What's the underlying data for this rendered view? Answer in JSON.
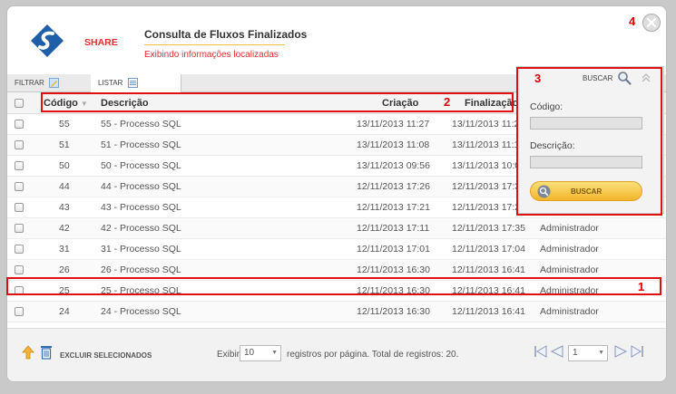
{
  "header": {
    "brand": "SHARE",
    "title": "Consulta de Fluxos Finalizados",
    "subtitle": "Exibindo informações localizadas"
  },
  "tabs": {
    "filter": "FILTRAR",
    "list": "LISTAR"
  },
  "table": {
    "columns": [
      "Código",
      "Descrição",
      "Criação",
      "Finalização"
    ],
    "rows": [
      {
        "codigo": "55",
        "descricao": "55 - Processo SQL",
        "criacao": "13/11/2013 11:27",
        "finalizacao": "13/11/2013 11:2",
        "usuario": ""
      },
      {
        "codigo": "51",
        "descricao": "51 - Processo SQL",
        "criacao": "13/11/2013 11:08",
        "finalizacao": "13/11/2013 11:1",
        "usuario": ""
      },
      {
        "codigo": "50",
        "descricao": "50 - Processo SQL",
        "criacao": "13/11/2013 09:56",
        "finalizacao": "13/11/2013 10:0",
        "usuario": ""
      },
      {
        "codigo": "44",
        "descricao": "44 - Processo SQL",
        "criacao": "12/11/2013 17:26",
        "finalizacao": "12/11/2013 17:3",
        "usuario": ""
      },
      {
        "codigo": "43",
        "descricao": "43 - Processo SQL",
        "criacao": "12/11/2013 17:21",
        "finalizacao": "12/11/2013 17:2",
        "usuario": ""
      },
      {
        "codigo": "42",
        "descricao": "42 - Processo SQL",
        "criacao": "12/11/2013 17:11",
        "finalizacao": "12/11/2013 17:35",
        "usuario": "Administrador"
      },
      {
        "codigo": "31",
        "descricao": "31 - Processo SQL",
        "criacao": "12/11/2013 17:01",
        "finalizacao": "12/11/2013 17:04",
        "usuario": "Administrador"
      },
      {
        "codigo": "26",
        "descricao": "26 - Processo SQL",
        "criacao": "12/11/2013 16:30",
        "finalizacao": "12/11/2013 16:41",
        "usuario": "Administrador"
      },
      {
        "codigo": "25",
        "descricao": "25 - Processo SQL",
        "criacao": "12/11/2013 16:30",
        "finalizacao": "12/11/2013 16:41",
        "usuario": "Administrador"
      },
      {
        "codigo": "24",
        "descricao": "24 - Processo SQL",
        "criacao": "12/11/2013 16:30",
        "finalizacao": "12/11/2013 16:41",
        "usuario": "Administrador"
      }
    ]
  },
  "search_panel": {
    "title": "BUSCAR",
    "codigo_label": "Código:",
    "descricao_label": "Descrição:",
    "button_label": "BUSCAR"
  },
  "footer": {
    "delete_selected": "EXCLUIR SELECIONADOS",
    "show_label": "Exibir",
    "page_size": "10",
    "records_text": "registros por página. Total de registros: 20.",
    "page": "1"
  },
  "annotations": [
    "1",
    "2",
    "3",
    "4"
  ],
  "colors": {
    "accent_red": "#e03030",
    "annotation_red": "#e01010",
    "button_yellow": "#f3b52a",
    "logo_blue": "#1f5fa8"
  }
}
